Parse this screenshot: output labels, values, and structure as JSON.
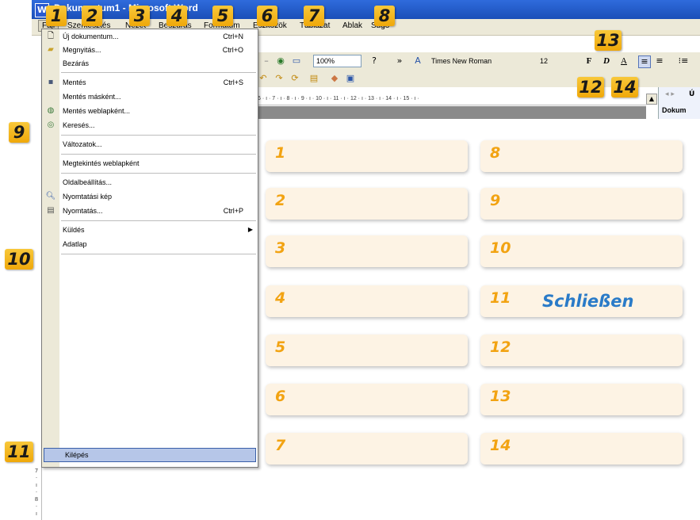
{
  "window": {
    "title": "Dokumentum1 - Microsoft Word",
    "app_icon": "word-app-icon"
  },
  "menubar": {
    "items": [
      "Fájl",
      "Szerkesztés",
      "Nézet",
      "Beszúrás",
      "Formátum",
      "Eszközök",
      "Táblázat",
      "Ablak",
      "Súgó"
    ]
  },
  "toolbar": {
    "zoom": "100%",
    "font": "Times New Roman",
    "font_size": "12",
    "bold_label": "F",
    "italic_label": "D",
    "underline_label": "A",
    "ruler_text": "6 · ı · 7 · ı · 8 · ı · 9 · ı · 10 · ı · 11 · ı · 12 · ı · 13 · ı · 14 · ı · 15 · ı ·"
  },
  "task_pane": {
    "title": "Dokum",
    "top_char": "Ú"
  },
  "vertical_ruler": [
    "7",
    "·",
    "ı",
    "·",
    "8",
    "·",
    "ı"
  ],
  "file_menu": {
    "items": [
      {
        "label": "Új dokumentum...",
        "shortcut": "Ctrl+N",
        "icon": "new-document-icon"
      },
      {
        "label": "Megnyitás...",
        "shortcut": "Ctrl+O",
        "icon": "open-folder-icon"
      },
      {
        "label": "Bezárás",
        "shortcut": "",
        "icon": ""
      },
      {
        "label": "Mentés",
        "shortcut": "Ctrl+S",
        "icon": "save-disk-icon"
      },
      {
        "label": "Mentés másként...",
        "shortcut": "",
        "icon": ""
      },
      {
        "label": "Mentés weblapként...",
        "shortcut": "",
        "icon": "save-web-icon"
      },
      {
        "label": "Keresés...",
        "shortcut": "",
        "icon": "search-files-icon"
      },
      {
        "label": "Változatok...",
        "shortcut": "",
        "icon": ""
      },
      {
        "label": "Megtekintés weblapként",
        "shortcut": "",
        "icon": ""
      },
      {
        "label": "Oldalbeállítás...",
        "shortcut": "",
        "icon": ""
      },
      {
        "label": "Nyomtatási kép",
        "shortcut": "",
        "icon": "print-preview-icon"
      },
      {
        "label": "Nyomtatás...",
        "shortcut": "Ctrl+P",
        "icon": "printer-icon"
      },
      {
        "label": "Küldés",
        "shortcut": "",
        "icon": ""
      },
      {
        "label": "Adatlap",
        "shortcut": "",
        "icon": ""
      },
      {
        "label": "Kilépés",
        "shortcut": "",
        "icon": ""
      }
    ]
  },
  "tags": [
    "1",
    "2",
    "3",
    "4",
    "5",
    "6",
    "7",
    "8",
    "9",
    "10",
    "11",
    "12",
    "13",
    "14"
  ],
  "answer_boxes": [
    {
      "number": "1",
      "answer": ""
    },
    {
      "number": "2",
      "answer": ""
    },
    {
      "number": "3",
      "answer": ""
    },
    {
      "number": "4",
      "answer": ""
    },
    {
      "number": "5",
      "answer": ""
    },
    {
      "number": "6",
      "answer": ""
    },
    {
      "number": "7",
      "answer": ""
    },
    {
      "number": "8",
      "answer": ""
    },
    {
      "number": "9",
      "answer": ""
    },
    {
      "number": "10",
      "answer": ""
    },
    {
      "number": "11",
      "answer": "Schließen"
    },
    {
      "number": "12",
      "answer": ""
    },
    {
      "number": "13",
      "answer": ""
    },
    {
      "number": "14",
      "answer": ""
    }
  ],
  "colors": {
    "tag": "#f4b523",
    "box": "#fdf3e4",
    "number": "#f2a312",
    "answer": "#2a7bc8",
    "menu_highlight": "#b6c6e8"
  }
}
